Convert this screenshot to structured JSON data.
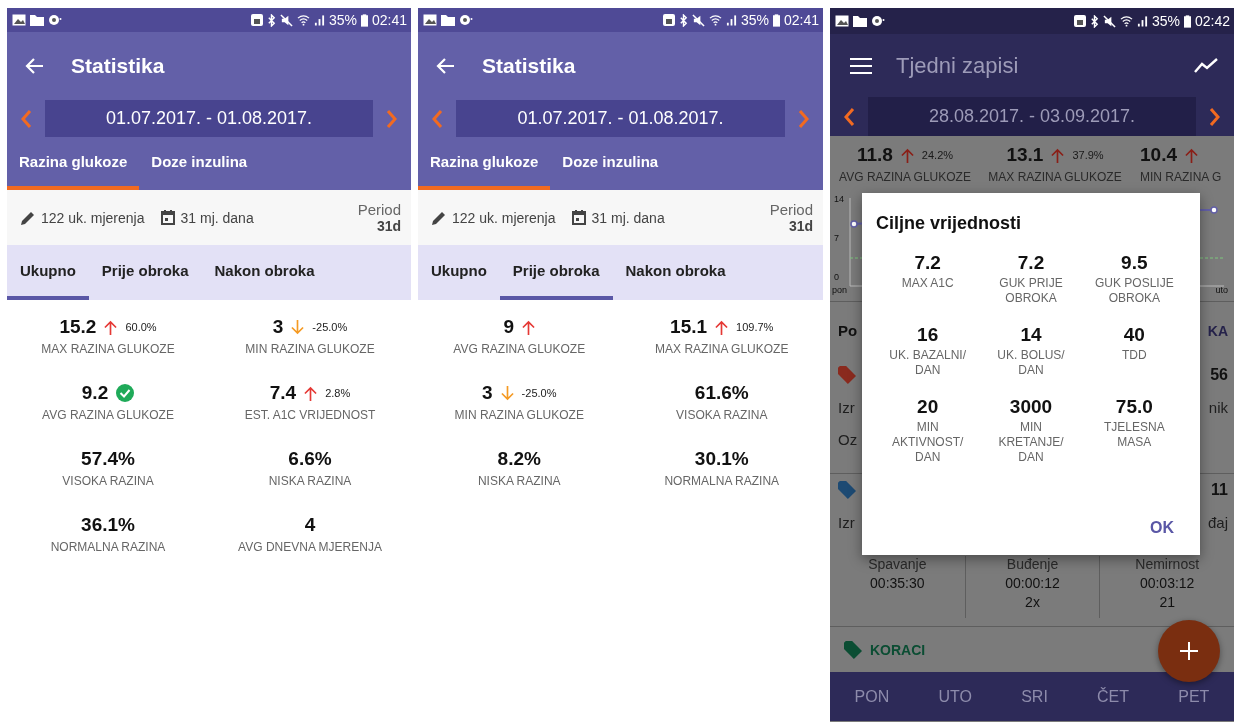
{
  "screens": [
    {
      "kind": "stats",
      "status_bar": {
        "battery": "35%",
        "time": "02:41"
      },
      "title": "Statistika",
      "date_range": "01.07.2017. - 01.08.2017.",
      "tabs": [
        {
          "label": "Razina glukoze",
          "selected": true
        },
        {
          "label": "Doze inzulina",
          "selected": false
        }
      ],
      "summary": {
        "measurements": "122 uk. mjerenja",
        "days": "31 mj. dana",
        "period_label": "Period",
        "period_value": "31d"
      },
      "subtabs": [
        {
          "label": "Ukupno",
          "selected": true
        },
        {
          "label": "Prije obroka",
          "selected": false
        },
        {
          "label": "Nakon obroka",
          "selected": false
        }
      ],
      "metrics": [
        {
          "value": "15.2",
          "kind": "up",
          "change": "60.0%",
          "label": "MAX RAZINA GLUKOZE"
        },
        {
          "value": "3",
          "kind": "down",
          "change": "-25.0%",
          "label": "MIN RAZINA GLUKOZE"
        },
        {
          "value": "9.2",
          "kind": "ok",
          "label": "AVG RAZINA GLUKOZE"
        },
        {
          "value": "7.4",
          "kind": "up",
          "change": "2.8%",
          "label": "EST. A1C VRIJEDNOST"
        },
        {
          "value": "57.4%",
          "kind": "plain",
          "label": "VISOKA RAZINA"
        },
        {
          "value": "6.6%",
          "kind": "plain",
          "label": "NISKA RAZINA"
        },
        {
          "value": "36.1%",
          "kind": "plain",
          "label": "NORMALNA RAZINA"
        },
        {
          "value": "4",
          "kind": "plain",
          "label": "AVG DNEVNA MJERENJA"
        }
      ]
    },
    {
      "kind": "stats",
      "status_bar": {
        "battery": "35%",
        "time": "02:41"
      },
      "title": "Statistika",
      "date_range": "01.07.2017. - 01.08.2017.",
      "tabs": [
        {
          "label": "Razina glukoze",
          "selected": true
        },
        {
          "label": "Doze inzulina",
          "selected": false
        }
      ],
      "summary": {
        "measurements": "122 uk. mjerenja",
        "days": "31 mj. dana",
        "period_label": "Period",
        "period_value": "31d"
      },
      "subtabs": [
        {
          "label": "Ukupno",
          "selected": false
        },
        {
          "label": "Prije obroka",
          "selected": true
        },
        {
          "label": "Nakon obroka",
          "selected": false
        }
      ],
      "metrics": [
        {
          "value": "9",
          "kind": "up",
          "label": "AVG RAZINA GLUKOZE"
        },
        {
          "value": "15.1",
          "kind": "up",
          "change": "109.7%",
          "label": "MAX RAZINA GLUKOZE"
        },
        {
          "value": "3",
          "kind": "down",
          "change": "-25.0%",
          "label": "MIN RAZINA GLUKOZE"
        },
        {
          "value": "61.6%",
          "kind": "plain",
          "label": "VISOKA RAZINA"
        },
        {
          "value": "8.2%",
          "kind": "plain",
          "label": "NISKA RAZINA"
        },
        {
          "value": "30.1%",
          "kind": "plain",
          "label": "NORMALNA RAZINA"
        }
      ]
    },
    {
      "kind": "weekly",
      "status_bar": {
        "battery": "35%",
        "time": "02:42"
      },
      "title": "Tjedni zapisi",
      "date_range": "28.08.2017. - 03.09.2017.",
      "metrics": [
        {
          "value": "11.8",
          "kind": "up",
          "change": "24.2%",
          "label": "AVG RAZINA GLUKOZE"
        },
        {
          "value": "13.1",
          "kind": "up",
          "change": "37.9%",
          "label": "MAX RAZINA GLUKOZE"
        },
        {
          "value": "10.4",
          "kind": "up",
          "label": "MIN RAZINA G"
        }
      ],
      "chart": {
        "y_labels": [
          "14",
          "7",
          "0"
        ],
        "x_labels": [
          "pon",
          "uto"
        ]
      },
      "section": {
        "title": "Po",
        "action": "KA"
      },
      "cards": [
        {
          "color": "#8a2a1e",
          "value": "56",
          "rows": [
            {
              "left": "Izr",
              "right": "nik"
            },
            {
              "left": "Oz"
            }
          ]
        },
        {
          "color": "#1d4a73",
          "value": "11",
          "rows": [
            {
              "left": "Izr",
              "right": "đaj"
            }
          ],
          "sleep": [
            {
              "label": "Spavanje",
              "time": "00:35:30"
            },
            {
              "label": "Buđenje",
              "time": "00:00:12",
              "count": "2x"
            },
            {
              "label": "Nemirnost",
              "time": "00:03:12",
              "count": "21"
            }
          ]
        }
      ],
      "steps_section": "KORACI",
      "bottom_nav": [
        "PON",
        "UTO",
        "SRI",
        "ČET",
        "PET"
      ],
      "dialog": {
        "title": "Ciljne vrijednosti",
        "button": "OK",
        "items": [
          {
            "value": "7.2",
            "label": "MAX A1C"
          },
          {
            "value": "7.2",
            "label": "GUK PRIJE OBROKA"
          },
          {
            "value": "9.5",
            "label": "GUK POSLIJE OBROKA"
          },
          {
            "value": "16",
            "label": "UK. BAZALNI/ DAN"
          },
          {
            "value": "14",
            "label": "UK. BOLUS/ DAN"
          },
          {
            "value": "40",
            "label": "TDD"
          },
          {
            "value": "20",
            "label": "MIN AKTIVNOST/ DAN"
          },
          {
            "value": "3000",
            "label": "MIN KRETANJE/ DAN"
          },
          {
            "value": "75.0",
            "label": "TJELESNA MASA"
          }
        ]
      }
    }
  ]
}
